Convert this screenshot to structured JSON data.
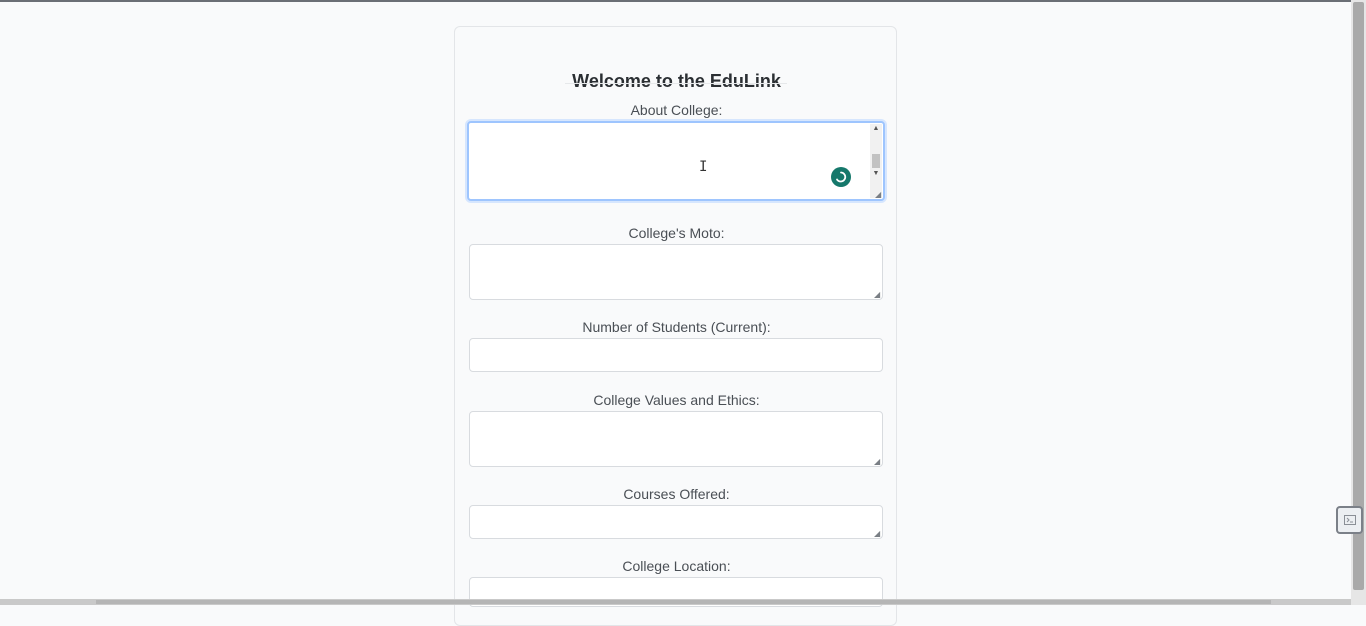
{
  "form": {
    "title": "Welcome to the EduLink",
    "fields": [
      {
        "label": "About College:",
        "value": "",
        "type": "textarea"
      },
      {
        "label": "College's Moto:",
        "value": "",
        "type": "textarea"
      },
      {
        "label": "Number of Students (Current):",
        "value": "",
        "type": "input"
      },
      {
        "label": "College Values and Ethics:",
        "value": "",
        "type": "textarea"
      },
      {
        "label": "Courses Offered:",
        "value": "",
        "type": "textarea"
      },
      {
        "label": "College Location:",
        "value": "",
        "type": "input"
      }
    ]
  },
  "icons": {
    "grammar_assistant": "grammar-assistant-icon",
    "cursor": "text-cursor-icon",
    "resize": "resize-grip-icon",
    "floating_tool": "floating-tool-icon"
  },
  "colors": {
    "focus_border": "#9ec5fe",
    "grammar_icon": "#15786b",
    "page_background": "#f9fafb"
  }
}
